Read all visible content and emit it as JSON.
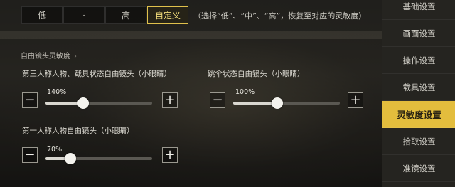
{
  "quality": {
    "options": [
      "低",
      "·",
      "高",
      "自定义"
    ],
    "note": "（选择“低”、“中”、“高”，恢复至对应的灵敏度）"
  },
  "section": {
    "title": "自由镜头灵敏度",
    "chevron": "›"
  },
  "sliders": [
    {
      "label": "第三人称人物、载具状态自由镜头（小眼睛）",
      "value_text": "140%",
      "fraction": 0.35
    },
    {
      "label": "跳伞状态自由镜头（小眼睛）",
      "value_text": "100%",
      "fraction": 0.41
    },
    {
      "label": "第一人称人物自由镜头（小眼睛）",
      "value_text": "70%",
      "fraction": 0.23
    }
  ],
  "controls": {
    "minus": "−",
    "plus": "+"
  },
  "sidebar": {
    "items": [
      "基础设置",
      "画面设置",
      "操作设置",
      "载具设置",
      "灵敏度设置",
      "拾取设置",
      "准镜设置"
    ],
    "active_index": 4,
    "accent": "#e3bd3d"
  }
}
